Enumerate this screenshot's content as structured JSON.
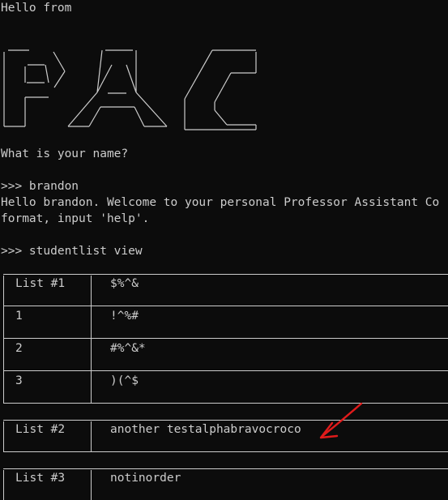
{
  "terminal": {
    "greeting": "Hello from",
    "banner": {
      "text": "PAC",
      "rows": [
        " _____     ____     ______",
        "|  __ \\   /    \\   /  ___|",
        "| |__| | /  /\\  \\ |  /",
        "|  ____//  /__\\  \\| |",
        "| |    /  /    \\  \\  \\____",
        "|_|   /__/      \\__\\______|"
      ]
    },
    "prompt_question": "What is your name?",
    "input1": ">>> brandon",
    "welcome_line1": "Hello brandon. Welcome to your personal Professor Assistant Co",
    "welcome_line2": "format, input 'help'.",
    "input2": ">>> studentlist view",
    "lists": [
      {
        "header_label": "List #1",
        "header_value": "$%^&",
        "rows": [
          {
            "label": "1",
            "value": "!^%#"
          },
          {
            "label": "2",
            "value": "#%^&*"
          },
          {
            "label": "3",
            "value": ")(^$"
          }
        ]
      },
      {
        "header_label": "List #2",
        "header_value": "another testalphabravocroco",
        "rows": []
      },
      {
        "header_label": "List #3",
        "header_value": "notinorder",
        "rows": []
      }
    ]
  },
  "colors": {
    "background": "#0c0c0c",
    "text": "#cccccc",
    "annotation": "#e01b1b"
  },
  "icons": {
    "annotation": "red-arrow-icon"
  }
}
